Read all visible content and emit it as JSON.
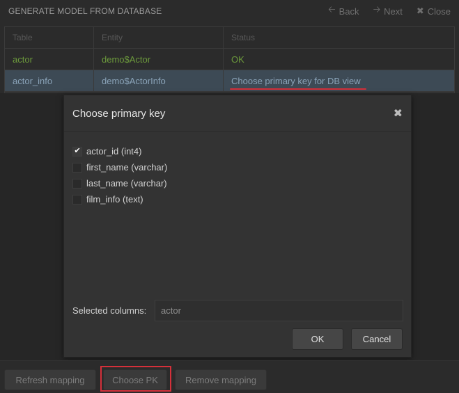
{
  "header": {
    "title": "GENERATE MODEL FROM DATABASE",
    "back_label": "Back",
    "next_label": "Next",
    "close_label": "Close"
  },
  "grid": {
    "columns": [
      "Table",
      "Entity",
      "Status"
    ],
    "rows": [
      {
        "table": "actor",
        "entity": "demo$Actor",
        "status": "OK"
      },
      {
        "table": "actor_info",
        "entity": "demo$ActorInfo",
        "status": "Choose primary key for DB view"
      }
    ]
  },
  "dialog": {
    "title": "Choose primary key",
    "close_icon": "✖",
    "columns": [
      {
        "label": "actor_id (int4)",
        "checked": true
      },
      {
        "label": "first_name (varchar)",
        "checked": false
      },
      {
        "label": "last_name (varchar)",
        "checked": false
      },
      {
        "label": "film_info (text)",
        "checked": false
      }
    ],
    "selected_label": "Selected columns:",
    "selected_value": "actor",
    "ok_label": "OK",
    "cancel_label": "Cancel"
  },
  "bottom": {
    "refresh_label": "Refresh mapping",
    "choose_pk_label": "Choose PK",
    "remove_label": "Remove mapping"
  },
  "colors": {
    "ok_status": "#6c9a3c",
    "selected_row": "#3d4a55",
    "highlight_red": "#d5303a"
  },
  "icons": {
    "back": "back-arrow-icon",
    "next": "next-arrow-icon",
    "close": "close-icon",
    "check": "checkmark-icon"
  }
}
